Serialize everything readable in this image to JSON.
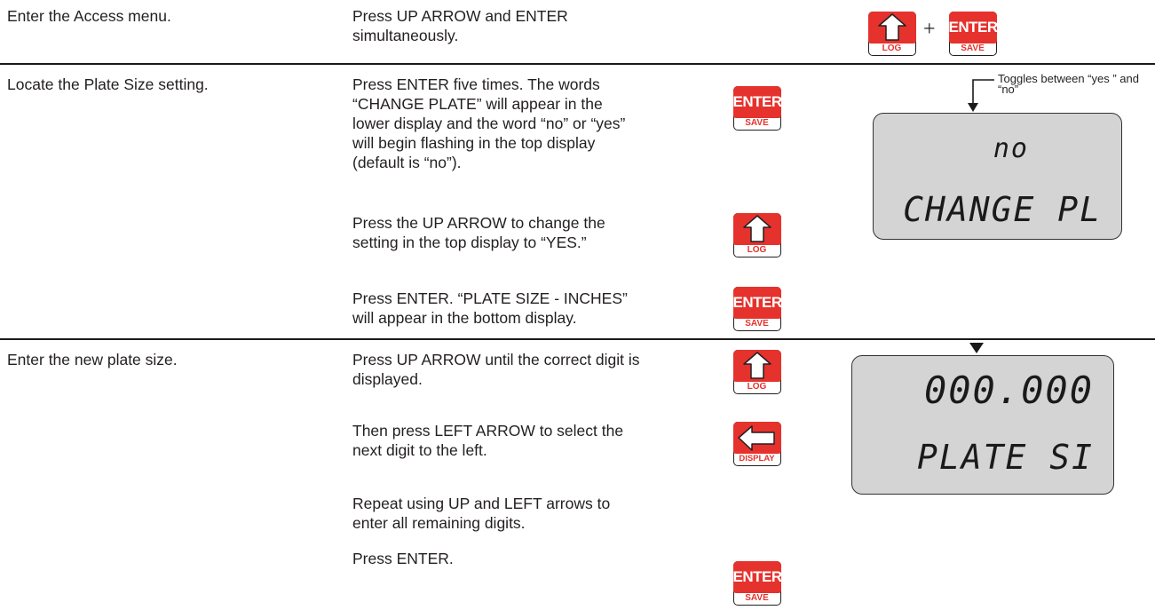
{
  "rows": [
    {
      "step": "Enter the Access menu.",
      "actions": [
        "Press UP ARROW and ENTER\nsimultaneously."
      ]
    },
    {
      "step": "Locate the Plate Size setting.",
      "actions": [
        "Press ENTER five times. The words\n“CHANGE PLATE” will appear in the\nlower display and the word “no” or “yes”\nwill begin flashing in the top display\n(default is “no”).",
        "Press the UP ARROW to change the\nsetting in the top display to “YES.”",
        "Press ENTER. “PLATE SIZE - INCHES”\nwill appear in the bottom display."
      ]
    },
    {
      "step": "Enter the new plate size.",
      "actions": [
        "Press UP ARROW until the correct digit is\ndisplayed.",
        "Then press LEFT ARROW to select the\nnext digit to the left.",
        "Repeat using UP and LEFT arrows to\nenter all remaining digits.",
        "Press ENTER."
      ]
    }
  ],
  "keys": {
    "enter_label": "ENTER",
    "save_label": "SAVE",
    "log_label": "LOG",
    "display_label": "DISPLAY",
    "plus": "+"
  },
  "displays": {
    "change_plate": {
      "top": "no",
      "bottom": "CHANGE PL"
    },
    "plate_size": {
      "top": "000.000",
      "bottom": "PLATE SI"
    }
  },
  "annotation": "Toggles between\n“yes ” and “no”",
  "colors": {
    "key_red": "#e5322d",
    "lcd_bg": "#d4d4d4",
    "text": "#231f20"
  }
}
